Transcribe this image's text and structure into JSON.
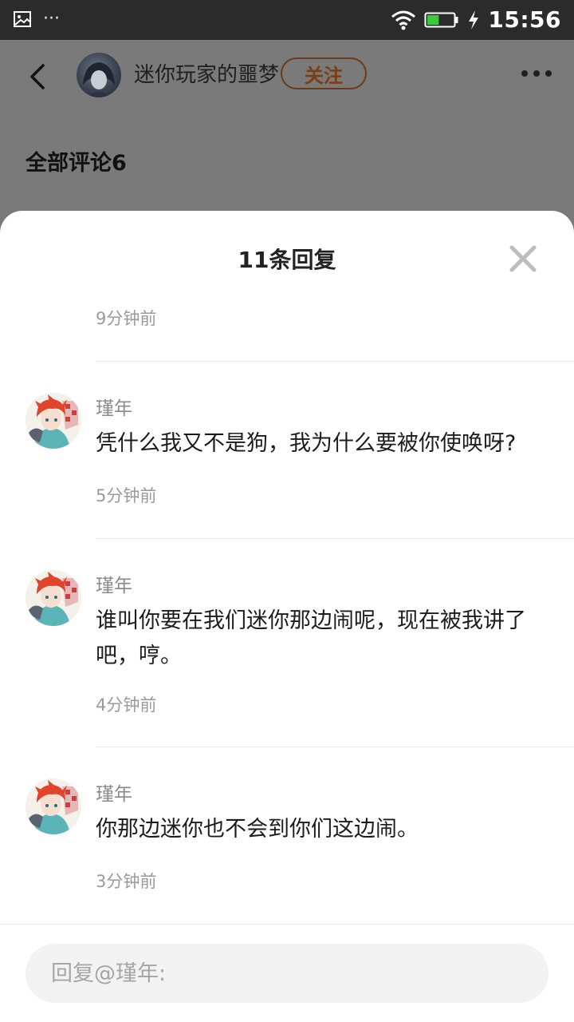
{
  "status_bar": {
    "time": "15:56",
    "left_icons": [
      "image-icon",
      "more-dots-icon"
    ],
    "right_icons": [
      "wifi-icon",
      "battery-icon",
      "charging-icon"
    ],
    "battery_level": 0.45
  },
  "background_page": {
    "author_name": "迷你玩家的噩梦",
    "follow_label": "关注",
    "all_comments_label": "全部评论6"
  },
  "sheet": {
    "title": "11条回复",
    "first_time": "9分钟前",
    "replies": [
      {
        "name": "瑾年",
        "text": "凭什么我又不是狗，我为什么要被你使唤呀?",
        "time": "5分钟前"
      },
      {
        "name": "瑾年",
        "text": "谁叫你要在我们迷你那边闹呢，现在被我讲了吧，哼。",
        "time": "4分钟前"
      },
      {
        "name": "瑾年",
        "text": "你那边迷你也不会到你们这边闹。",
        "time": "3分钟前"
      }
    ]
  },
  "input": {
    "placeholder": "回复@瑾年:"
  },
  "colors": {
    "status_bar": "#2b2b2b",
    "dim_overlay": "#7a7a7a",
    "follow_border": "#6b3a16",
    "secondary_text": "#9a9a9a"
  }
}
